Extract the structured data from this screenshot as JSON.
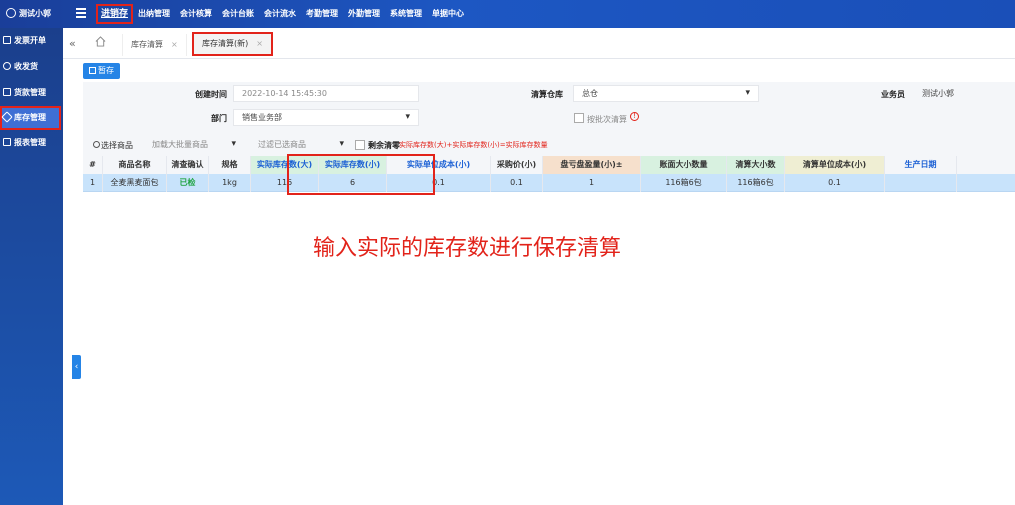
{
  "app": {
    "brand": "测试小郭"
  },
  "topnav": [
    "进销存",
    "出纳管理",
    "会计核算",
    "会计台账",
    "会计流水",
    "考勤管理",
    "外勤管理",
    "系统管理",
    "单据中心"
  ],
  "sidebar": [
    "发票开单",
    "收发货",
    "货款管理",
    "库存管理",
    "报表管理"
  ],
  "tabs": {
    "t1": "库存清算",
    "t2": "库存清算(新)"
  },
  "toolbar": {
    "save": "暂存"
  },
  "form": {
    "created_label": "创建时间",
    "created_value": "2022-10-14 15:45:30",
    "warehouse_label": "清算仓库",
    "warehouse_value": "总仓",
    "clerk_label": "业务员",
    "clerk_value": "测试小郭",
    "dept_label": "部门",
    "dept_value": "销售业务部",
    "batch_label": "按批次清算"
  },
  "filter": {
    "select_label": "选择商品",
    "load_placeholder": "加载大批量商品",
    "filter_placeholder": "过滤已选商品",
    "remaining_label": "剩余清零",
    "note": "实际库存数(大)+实际库存数(小)=实际库存数量"
  },
  "table": {
    "headers": [
      "#",
      "商品名称",
      "清查确认",
      "规格",
      "实际库存数(大)",
      "实际库存数(小)",
      "实际单位成本(小)",
      "采购价(小)",
      "盘亏盘盈量(小)±",
      "账面大小数量",
      "清算大小数",
      "清算单位成本(小)",
      "生产日期"
    ],
    "row": [
      "1",
      "全麦黑麦面包",
      "已检",
      "1kg",
      "116",
      "6",
      "0.1",
      "0.1",
      "1",
      "116箱6包",
      "116箱6包",
      "0.1",
      ""
    ]
  },
  "annotation": "输入实际的库存数进行保存清算",
  "colors": {
    "accent": "#e2231a",
    "primary": "#2584e6",
    "row_selected": "#c8e3fb"
  }
}
